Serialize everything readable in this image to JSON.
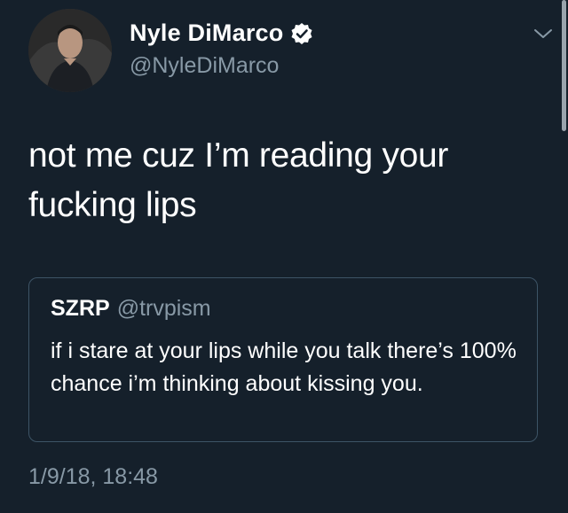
{
  "tweet": {
    "author": {
      "display_name": "Nyle DiMarco",
      "handle": "@NyleDiMarco",
      "verified": true
    },
    "text": "not me cuz I’m reading your fucking lips",
    "timestamp": "1/9/18, 18:48",
    "quoted_tweet": {
      "display_name": "SZRP",
      "handle": "@trvpism",
      "text": "if i stare at your lips while you talk there’s 100% chance i’m thinking about kissing you."
    }
  },
  "colors": {
    "background": "#15202b",
    "primary_text": "#ffffff",
    "secondary_text": "#8899a6",
    "border": "#3d5466"
  },
  "icons": {
    "verified": "verified-badge-icon",
    "menu": "chevron-down-icon"
  }
}
